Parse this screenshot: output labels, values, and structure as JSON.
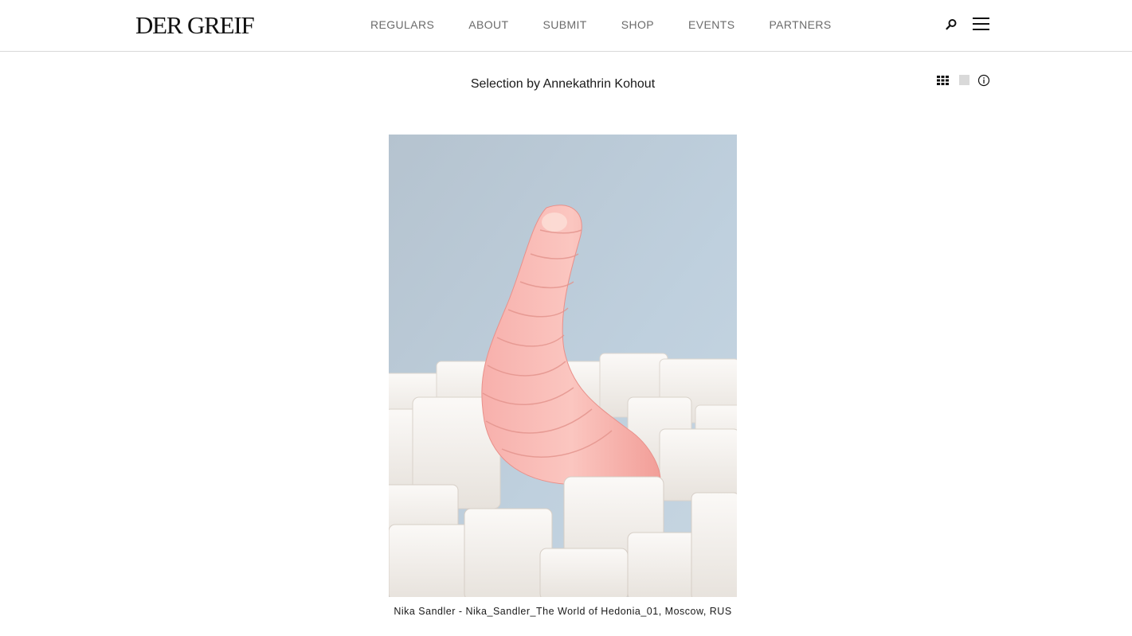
{
  "header": {
    "logo": "DER GREIF",
    "nav": [
      "REGULARS",
      "ABOUT",
      "SUBMIT",
      "SHOP",
      "EVENTS",
      "PARTNERS"
    ],
    "icons": {
      "search": "search-icon",
      "menu": "hamburger-menu-icon"
    }
  },
  "gallery": {
    "title": "Selection by Annekathrin Kohout",
    "view_controls": [
      "grid-view-icon",
      "single-view-icon",
      "info-icon"
    ],
    "caption": "Nika Sandler - Nika_Sandler_The World of Hedonia_01, Moscow, RUS"
  },
  "colors": {
    "background": "#ffffff",
    "nav_text": "#6b6b6b",
    "divider": "#d8d8d8",
    "photo_sky": "#b8c8d8",
    "worm": "#f4a6a0"
  }
}
